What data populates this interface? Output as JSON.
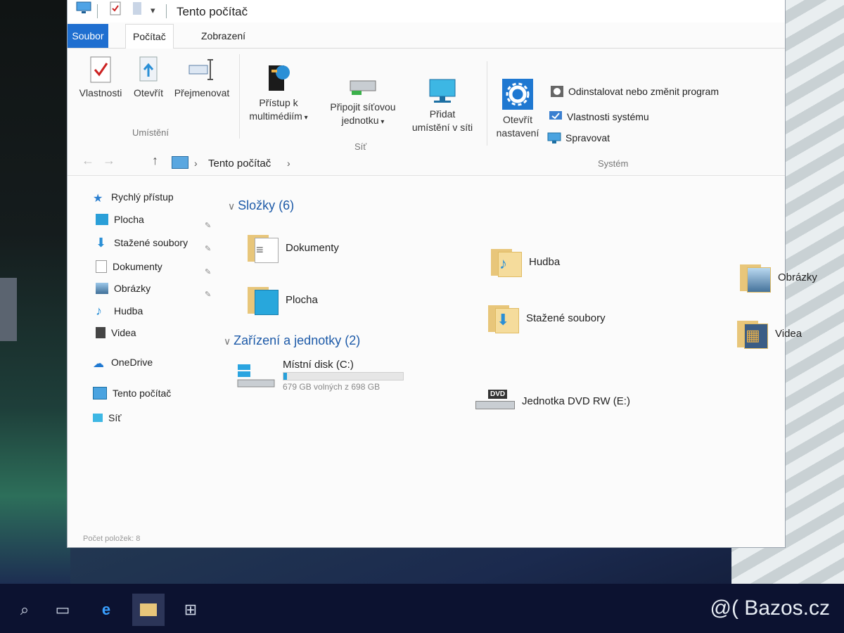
{
  "window": {
    "title": "Tento počítač"
  },
  "ribbon": {
    "tabs": [
      "Soubor",
      "Počítač",
      "Zobrazení"
    ],
    "location_group": {
      "label": "Umístění",
      "buttons": [
        "Vlastnosti",
        "Otevřít",
        "Přejmenovat"
      ]
    },
    "network_group": {
      "label": "Síť",
      "buttons": [
        {
          "line1": "Přístup k",
          "line2": "multimédiím"
        },
        {
          "line1": "Připojit síťovou",
          "line2": "jednotku"
        },
        {
          "line1": "Přidat",
          "line2": "umístění v síti"
        }
      ]
    },
    "system_group": {
      "label": "Systém",
      "open_settings": {
        "line1": "Otevřít",
        "line2": "nastavení"
      },
      "links": [
        "Odinstalovat nebo změnit program",
        "Vlastnosti systému",
        "Spravovat"
      ]
    }
  },
  "address_bar": {
    "path": "Tento počítač"
  },
  "nav_pane": {
    "quick_access": "Rychlý přístup",
    "quick_items": [
      "Plocha",
      "Stažené soubory",
      "Dokumenty",
      "Obrázky",
      "Hudba",
      "Videa"
    ],
    "onedrive": "OneDrive",
    "this_pc": "Tento počítač",
    "network": "Síť"
  },
  "content": {
    "folders_header": "Složky (6)",
    "folders": [
      "Dokumenty",
      "Hudba",
      "Obrázky",
      "Plocha",
      "Stažené soubory",
      "Videa"
    ],
    "devices_header": "Zařízení a jednotky (2)",
    "local_disk": {
      "name": "Místní disk (C:)",
      "free_text": "679 GB volných z 698 GB",
      "used_fraction": 0.027
    },
    "dvd": {
      "name": "Jednotka DVD RW (E:)",
      "badge": "DVD"
    }
  },
  "status_bar": {
    "text": "Počet položek: 8"
  },
  "watermark": "@( Bazos.cz",
  "colors": {
    "accent": "#1f6fd0",
    "file_tab": "#1f6fd0",
    "section_title": "#1d5aa8",
    "taskbar": "#0c1230"
  }
}
